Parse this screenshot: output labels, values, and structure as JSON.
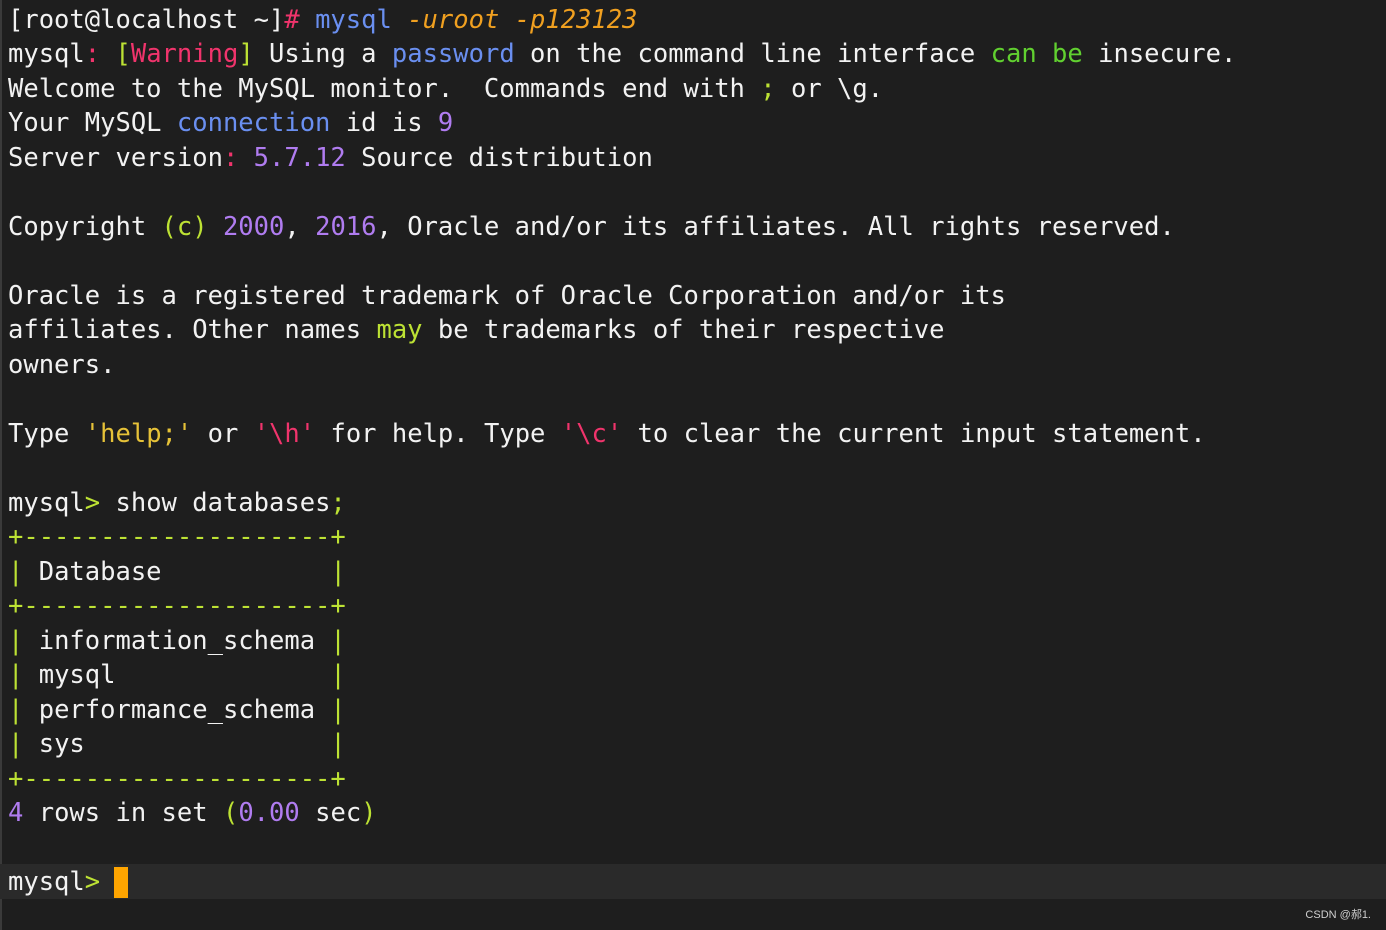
{
  "colors": {
    "background": "#1e1e1e",
    "foreground": "#f2f2f2",
    "keyword_blue": "#6a8ff0",
    "argument_orange": "#f0a020",
    "punctuation_magenta": "#f0346c",
    "keyword_green": "#61d030",
    "table_border_green": "#bde234",
    "number_purple": "#b07cf0",
    "string_yellow": "#e6c238",
    "cursor": "#ffa500"
  },
  "terminal": {
    "prompt_shell": "[root@localhost ~]",
    "prompt_hash": "#",
    "command_mysql": "mysql",
    "arg_user": "-uroot",
    "arg_password": "-p123123",
    "warning": {
      "prefix": "mysql",
      "colon": ":",
      "bracket_open": "[",
      "label": "Warning",
      "bracket_close": "]",
      "t1": "Using a",
      "password_word": "password",
      "t2": "on the command line interface",
      "can_word": "can",
      "be_word": "be",
      "t3": "insecure."
    },
    "welcome": {
      "t1": "Welcome to the MySQL monitor.  Commands end with",
      "semicolon": ";",
      "t2": "or \\g."
    },
    "connection": {
      "t1": "Your MySQL",
      "connection_word": "connection",
      "t2": "id is",
      "id": "9"
    },
    "server_version": {
      "label": "Server version",
      "colon": ":",
      "version": "5.7.12",
      "rest": "Source distribution"
    },
    "copyright": {
      "t1": "Copyright",
      "c": "(c)",
      "year1": "2000",
      "comma1": ",",
      "year2": "2016",
      "rest": ", Oracle and/or its affiliates. All rights reserved."
    },
    "trademark_line1": "Oracle is a registered trademark of Oracle Corporation and/or its",
    "trademark_line2": {
      "t1": "affiliates. Other names",
      "may_word": "may",
      "t2": "be trademarks of their respective"
    },
    "trademark_line3": "owners.",
    "help": {
      "t1": "Type",
      "help_str": "'help;'",
      "t2": "or",
      "h_str": "'\\h'",
      "t3": "for help. Type",
      "c_str": "'\\c'",
      "t4": "to clear the current input statement."
    },
    "query": {
      "prompt": "mysql",
      "gt": ">",
      "command": "show databases",
      "semicolon": ";"
    },
    "table": {
      "border": "+--------------------+",
      "pipe": "|",
      "header": "Database",
      "rows": [
        "information_schema",
        "mysql",
        "performance_schema",
        "sys"
      ]
    },
    "result": {
      "count": "4",
      "t1": "rows in set",
      "paren_open": "(",
      "time": "0.00",
      "t2": "sec",
      "paren_close": ")"
    },
    "final_prompt": {
      "prompt": "mysql",
      "gt": ">"
    }
  },
  "watermark": "CSDN @郝1."
}
